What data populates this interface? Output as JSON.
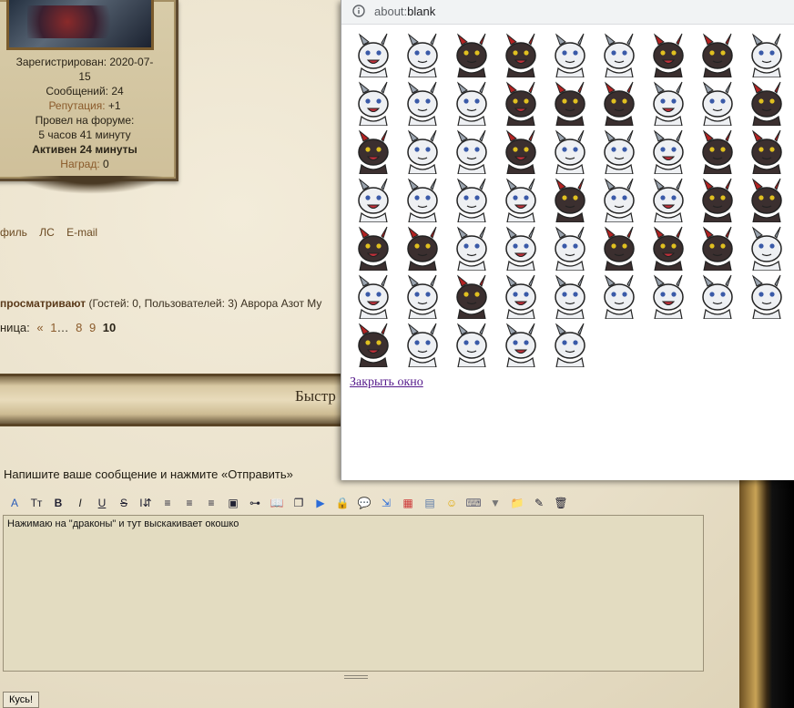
{
  "profile": {
    "registered_line1": "Зарегистрирован: 2020-07-",
    "registered_line2": "15",
    "posts": "Сообщений: 24",
    "reputation_label": "Репутация:",
    "reputation_value": "+1",
    "time_line1": "Провел на форуме:",
    "time_line2": "5 часов 41 минуту",
    "active": "Активен 24 минуты",
    "awards_label": "Наград:",
    "awards_value": "0"
  },
  "profile_links": [
    "филь",
    "ЛС",
    "E-mail"
  ],
  "viewing": {
    "label": "просматривают",
    "text": "(Гостей: 0, Пользователей: 3) Аврора Азот Му"
  },
  "pager": {
    "label": "ница:",
    "prev": "«",
    "pages": [
      "1",
      "…",
      "8",
      "9"
    ],
    "current": "10"
  },
  "banner": {
    "title": "Быстр"
  },
  "editor": {
    "hint": "Напишите ваше сообщение и нажмите «Отправить»",
    "text": "Нажимаю на \"драконы\" и тут выскакивает окошко",
    "submit": "Кусь!",
    "toolbar": [
      "font-color-icon",
      "font-size-icon",
      "bold-icon",
      "italic-icon",
      "underline-icon",
      "strike-icon",
      "text-height-icon",
      "align-left-icon",
      "align-center-icon",
      "align-right-icon",
      "image-icon",
      "link-icon",
      "book-icon",
      "copy-icon",
      "media-icon",
      "lock-icon",
      "speech-icon",
      "insert-icon",
      "color-grid-icon",
      "table-icon",
      "smiley-icon",
      "keyboard-icon",
      "dropdown-arrow-icon",
      "folder-icon",
      "edit-icon",
      "trash-icon"
    ]
  },
  "popup": {
    "url_prefix": "about:",
    "url_rest": "blank",
    "close": "Закрыть окно",
    "sticker_count": 59,
    "colors": {
      "white_dragon": "#eef0f3",
      "black_dragon": "#3b2f2f",
      "red_accent": "#b22222"
    }
  },
  "colors": {
    "parchment": "#e9e1cd",
    "frame": "#5d4a30",
    "link": "#8a5a2a"
  }
}
